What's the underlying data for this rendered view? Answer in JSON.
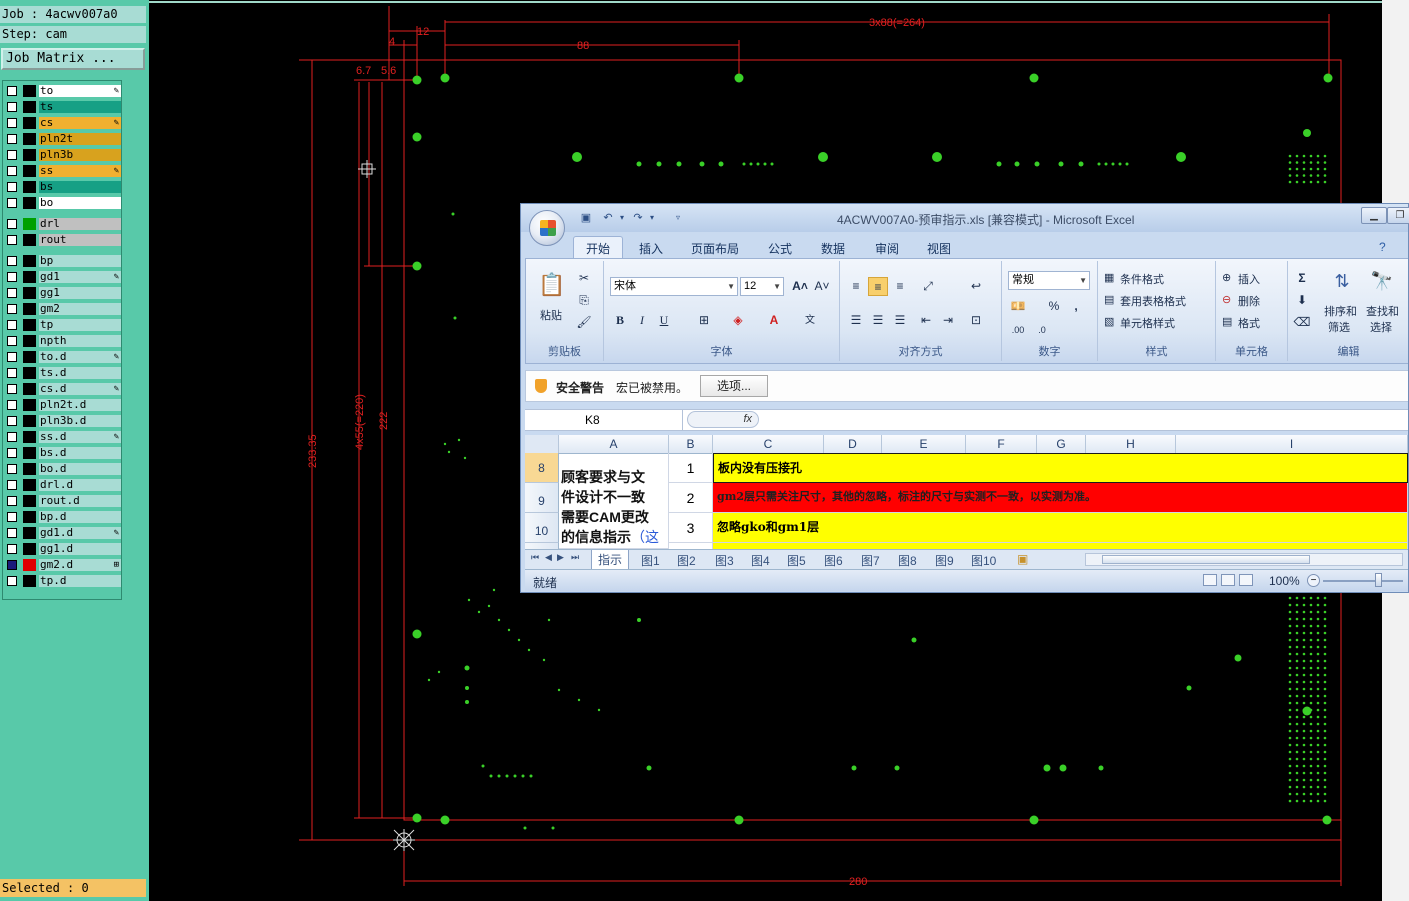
{
  "cam": {
    "job_label": "Job : 4acwv007a0",
    "step_label": "Step: cam",
    "job_matrix_label": "Job Matrix ...",
    "selected_label": "Selected : 0",
    "layers": [
      {
        "name": "to",
        "color": "#ffffff",
        "swatch": "#000000",
        "mark": "✎"
      },
      {
        "name": "ts",
        "color": "#16a085",
        "swatch": "#000000",
        "mark": ""
      },
      {
        "name": "cs",
        "color": "#f0b030",
        "swatch": "#000000",
        "mark": "✎"
      },
      {
        "name": "pln2t",
        "color": "#d8a21e",
        "swatch": "#000000",
        "mark": ""
      },
      {
        "name": "pln3b",
        "color": "#d8a21e",
        "swatch": "#000000",
        "mark": ""
      },
      {
        "name": "ss",
        "color": "#f0b030",
        "swatch": "#000000",
        "mark": "✎"
      },
      {
        "name": "bs",
        "color": "#16a085",
        "swatch": "#000000",
        "mark": ""
      },
      {
        "name": "bo",
        "color": "#ffffff",
        "swatch": "#000000",
        "mark": ""
      },
      {
        "name": "drl",
        "color": "#c0c0c0",
        "swatch": "#00a000",
        "mark": ""
      },
      {
        "name": "rout",
        "color": "#c0c0c0",
        "swatch": "#000000",
        "mark": ""
      },
      {
        "name": "bp",
        "color": "#a8dcd4",
        "swatch": "#000000",
        "mark": ""
      },
      {
        "name": "gd1",
        "color": "#a8dcd4",
        "swatch": "#000000",
        "mark": "✎"
      },
      {
        "name": "gg1",
        "color": "#a8dcd4",
        "swatch": "#000000",
        "mark": ""
      },
      {
        "name": "gm2",
        "color": "#a8dcd4",
        "swatch": "#000000",
        "mark": ""
      },
      {
        "name": "tp",
        "color": "#a8dcd4",
        "swatch": "#000000",
        "mark": ""
      },
      {
        "name": "npth",
        "color": "#a8dcd4",
        "swatch": "#000000",
        "mark": ""
      },
      {
        "name": "to.d",
        "color": "#a8dcd4",
        "swatch": "#000000",
        "mark": "✎"
      },
      {
        "name": "ts.d",
        "color": "#a8dcd4",
        "swatch": "#000000",
        "mark": ""
      },
      {
        "name": "cs.d",
        "color": "#a8dcd4",
        "swatch": "#000000",
        "mark": "✎"
      },
      {
        "name": "pln2t.d",
        "color": "#a8dcd4",
        "swatch": "#000000",
        "mark": ""
      },
      {
        "name": "pln3b.d",
        "color": "#a8dcd4",
        "swatch": "#000000",
        "mark": ""
      },
      {
        "name": "ss.d",
        "color": "#a8dcd4",
        "swatch": "#000000",
        "mark": "✎"
      },
      {
        "name": "bs.d",
        "color": "#a8dcd4",
        "swatch": "#000000",
        "mark": ""
      },
      {
        "name": "bo.d",
        "color": "#a8dcd4",
        "swatch": "#000000",
        "mark": ""
      },
      {
        "name": "drl.d",
        "color": "#a8dcd4",
        "swatch": "#000000",
        "mark": ""
      },
      {
        "name": "rout.d",
        "color": "#a8dcd4",
        "swatch": "#000000",
        "mark": ""
      },
      {
        "name": "bp.d",
        "color": "#a8dcd4",
        "swatch": "#000000",
        "mark": ""
      },
      {
        "name": "gd1.d",
        "color": "#a8dcd4",
        "swatch": "#000000",
        "mark": "✎"
      },
      {
        "name": "gg1.d",
        "color": "#a8dcd4",
        "swatch": "#000000",
        "mark": ""
      },
      {
        "name": "gm2.d",
        "color": "#a8dcd4",
        "swatch": "#e00000",
        "mark": "⊞",
        "checked": true
      },
      {
        "name": "tp.d",
        "color": "#a8dcd4",
        "swatch": "#000000",
        "mark": ""
      }
    ],
    "dimensions": {
      "d12": "12",
      "d4": "4",
      "d88": "88",
      "d3x88": "3x88(=264)",
      "d67": "6.7",
      "d56": "5.6",
      "d23335": "233.35",
      "d4x55": "4x55(=220)",
      "d222": "222",
      "d280": "280"
    }
  },
  "excel": {
    "title": "4ACWV007A0-预审指示.xls  [兼容模式] - Microsoft Excel",
    "tabs": [
      "开始",
      "插入",
      "页面布局",
      "公式",
      "数据",
      "审阅",
      "视图"
    ],
    "active_tab": "开始",
    "ribbon": {
      "paste": "粘贴",
      "clipboard": "剪贴板",
      "font_name": "宋体",
      "font_size": "12",
      "font": "字体",
      "align": "对齐方式",
      "number_format": "常规",
      "number": "数字",
      "cond_format": "条件格式",
      "table_format": "套用表格格式",
      "cell_style": "单元格样式",
      "styles": "样式",
      "insert": "插入",
      "delete": "删除",
      "format": "格式",
      "cells": "单元格",
      "sort_filter": "排序和",
      "sort_filter2": "筛选",
      "find_select": "查找和",
      "find_select2": "选择",
      "editing": "编辑"
    },
    "security": {
      "warning": "安全警告",
      "message": "宏已被禁用。",
      "options": "选项..."
    },
    "name_box": "K8",
    "fx": "fx",
    "columns": [
      "A",
      "B",
      "C",
      "D",
      "E",
      "F",
      "G",
      "H",
      "I"
    ],
    "rows": [
      {
        "num": "8",
        "no": "1",
        "text": "板内没有压接孔",
        "bg": "#ffff00"
      },
      {
        "num": "9",
        "no": "2",
        "text": "gm2层只需关注尺寸，其他的忽略，标注的尺寸与实测不一致，以实测为准。",
        "bg": "#ff0000"
      },
      {
        "num": "10",
        "no": "3",
        "text": "忽略gko和gm1层",
        "bg": "#ffff00"
      }
    ],
    "merged_a_text_lines": [
      "顾客要求与文",
      "件设计不一致",
      "需要CAM更改",
      "的信息指示"
    ],
    "merged_a_tail": "（这",
    "sheets": [
      "指示",
      "图1",
      "图2",
      "图3",
      "图4",
      "图5",
      "图6",
      "图7",
      "图8",
      "图9",
      "图10"
    ],
    "status": "就绪",
    "zoom": "100%"
  }
}
